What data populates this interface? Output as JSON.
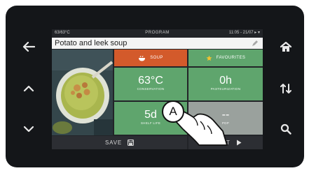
{
  "status_bar": {
    "left": "63/63°C",
    "title": "PROGRAM",
    "right": "11:05 - 21/07 ▸ ▾"
  },
  "recipe": {
    "title": "Potato and leek soup"
  },
  "tiles": {
    "category": {
      "label": "SOUP",
      "icon": "soup-bowl-icon"
    },
    "favourites": {
      "label": "FAVOURITES",
      "icon": "star-icon"
    },
    "temperature": {
      "value": "63°C",
      "label": "CONSERVATION"
    },
    "time": {
      "value": "0h",
      "label": "PASTEURIZATION"
    },
    "date": {
      "value": "5d",
      "label": "SHELF LIFE"
    },
    "pdp": {
      "value": "--",
      "label": "PDP"
    }
  },
  "bottom": {
    "save_label": "SAVE",
    "start_label": "START"
  },
  "callout": {
    "label": "A"
  },
  "side_buttons": [
    "back-arrow-icon",
    "chevron-up-icon",
    "chevron-down-icon",
    "home-icon",
    "sort-arrows-icon",
    "search-icon"
  ],
  "colors": {
    "soup_tile": "#d35a2b",
    "green_tile": "#5fa56d",
    "grey_tile": "#9aa19d",
    "device": "#141619"
  }
}
